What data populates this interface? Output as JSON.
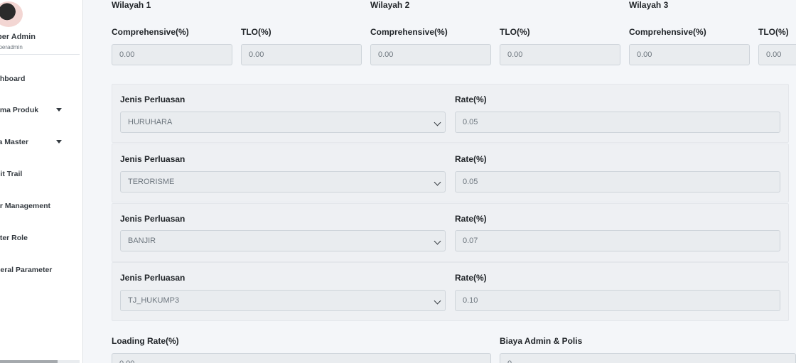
{
  "sidebar": {
    "user_name": "per Admin",
    "user_role": "uperadmin",
    "items": [
      {
        "label": "shboard"
      },
      {
        "label": "ema Produk"
      },
      {
        "label": "ta Master"
      },
      {
        "label": "dit Trail"
      },
      {
        "label": "er Management"
      },
      {
        "label": "ster Role"
      },
      {
        "label": "neral Parameter"
      }
    ]
  },
  "wilayah": [
    {
      "title": "Wilayah 1",
      "comprehensive_label": "Comprehensive(%)",
      "comprehensive_value": "0.00",
      "tlo_label": "TLO(%)",
      "tlo_value": "0.00"
    },
    {
      "title": "Wilayah 2",
      "comprehensive_label": "Comprehensive(%)",
      "comprehensive_value": "0.00",
      "tlo_label": "TLO(%)",
      "tlo_value": "0.00"
    },
    {
      "title": "Wilayah 3",
      "comprehensive_label": "Comprehensive(%)",
      "comprehensive_value": "0.00",
      "tlo_label": "TLO(%)",
      "tlo_value": "0.00"
    }
  ],
  "perluasan": [
    {
      "jenis_label": "Jenis Perluasan",
      "jenis_value": "HURUHARA",
      "rate_label": "Rate(%)",
      "rate_value": "0.05"
    },
    {
      "jenis_label": "Jenis Perluasan",
      "jenis_value": "TERORISME",
      "rate_label": "Rate(%)",
      "rate_value": "0.05"
    },
    {
      "jenis_label": "Jenis Perluasan",
      "jenis_value": "BANJIR",
      "rate_label": "Rate(%)",
      "rate_value": "0.07"
    },
    {
      "jenis_label": "Jenis Perluasan",
      "jenis_value": "TJ_HUKUMP3",
      "rate_label": "Rate(%)",
      "rate_value": "0.10"
    }
  ],
  "loading": {
    "label": "Loading Rate(%)",
    "value": "0.00"
  },
  "biaya": {
    "label": "Biaya Admin & Polis",
    "value": "0"
  }
}
